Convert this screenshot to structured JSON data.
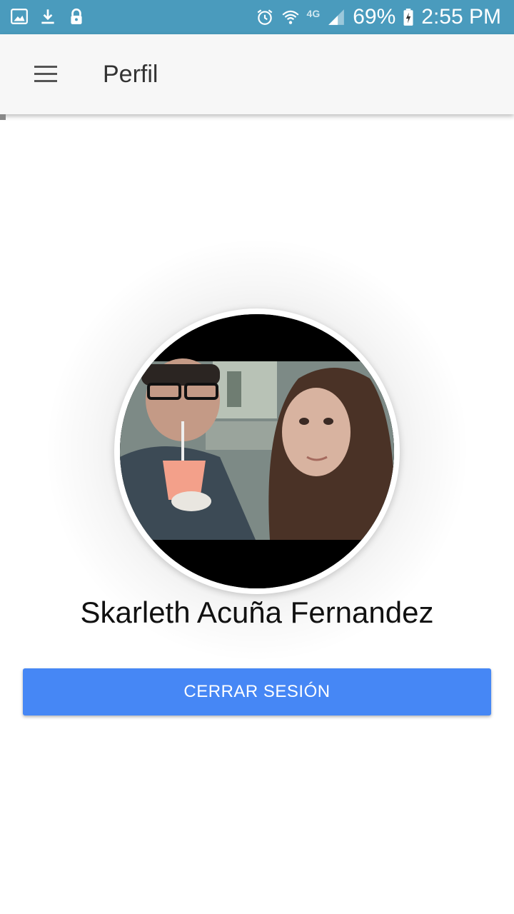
{
  "status_bar": {
    "battery_percent": "69%",
    "time": "2:55 PM",
    "network_label": "4G",
    "icons_left": [
      "gallery-icon",
      "download-icon",
      "lock-icon"
    ],
    "icons_right": [
      "alarm-icon",
      "wifi-icon",
      "signal-icon",
      "battery-charging-icon"
    ]
  },
  "app_bar": {
    "title": "Perfil",
    "menu_icon": "hamburger-menu-icon"
  },
  "profile": {
    "name": "Skarleth Acuña Fernandez",
    "avatar_icon": "profile-photo"
  },
  "actions": {
    "logout_label": "CERRAR SESIÓN"
  },
  "colors": {
    "status_bar": "#4a9bbd",
    "app_bar": "#f7f7f7",
    "primary_button": "#4687f5"
  }
}
